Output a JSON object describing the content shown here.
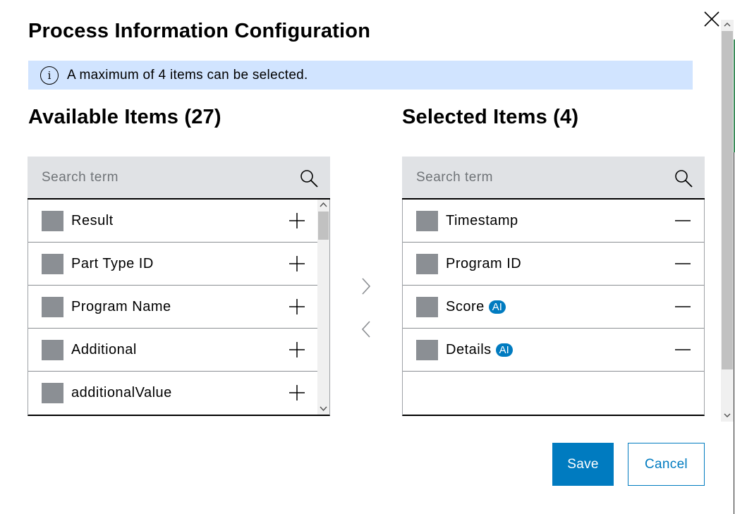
{
  "dialog": {
    "title": "Process Information Configuration",
    "notice": "A maximum of 4 items can be selected.",
    "save_label": "Save",
    "cancel_label": "Cancel"
  },
  "available": {
    "heading": "Available Items (27)",
    "search_placeholder": "Search term",
    "items": [
      {
        "label": "Result"
      },
      {
        "label": "Part Type ID"
      },
      {
        "label": "Program Name"
      },
      {
        "label": "Additional"
      },
      {
        "label": "additionalValue"
      }
    ]
  },
  "selected": {
    "heading": "Selected Items (4)",
    "search_placeholder": "Search term",
    "items": [
      {
        "label": "Timestamp",
        "badge": ""
      },
      {
        "label": "Program ID",
        "badge": ""
      },
      {
        "label": "Score",
        "badge": "AI"
      },
      {
        "label": "Details",
        "badge": "AI"
      }
    ]
  },
  "icons": {
    "close": "close-icon",
    "info": "info-icon",
    "search": "search-icon",
    "add": "plus-icon",
    "remove": "minus-icon",
    "move_right": "chevron-right-icon",
    "move_left": "chevron-left-icon"
  },
  "colors": {
    "accent": "#007bc0",
    "notice_bg": "#d1e4ff",
    "search_bg": "#e0e2e5",
    "swatch": "#8b8f94"
  }
}
